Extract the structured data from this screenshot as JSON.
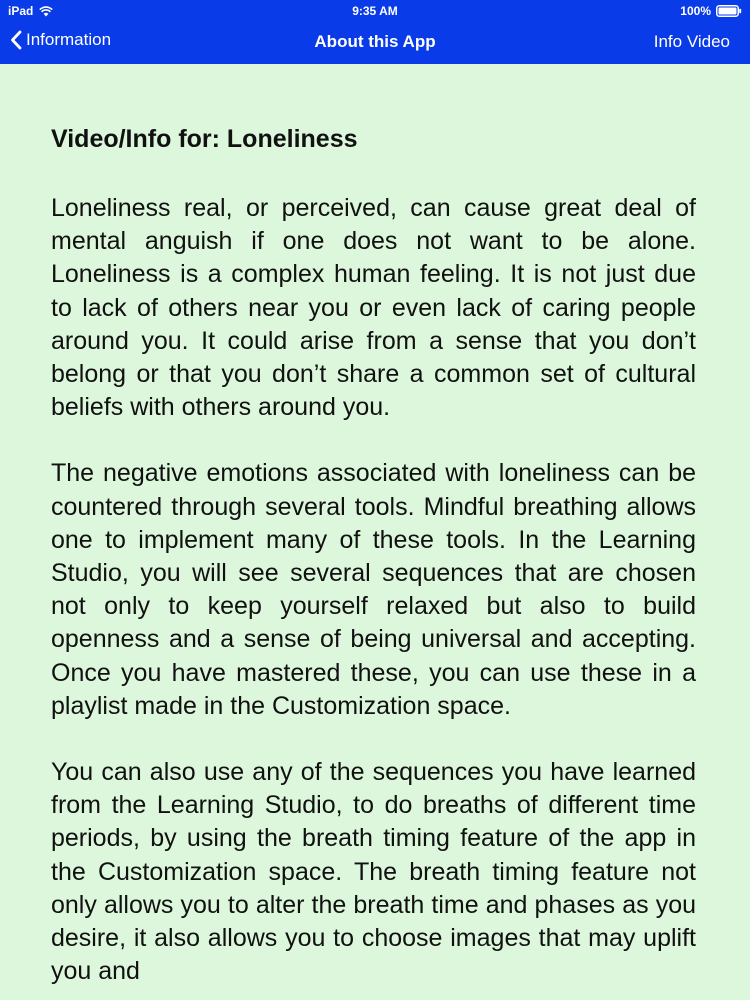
{
  "status_bar": {
    "device": "iPad",
    "time": "9:35 AM",
    "battery": "100%"
  },
  "nav": {
    "back_label": "Information",
    "title": "About this App",
    "right_label": "Info Video"
  },
  "content": {
    "heading": "Video/Info for: Loneliness",
    "paragraphs": [
      "Loneliness real, or perceived, can cause great deal of mental anguish if one does not want to be alone. Loneliness is a complex human feeling. It is not just due to lack of others near you or even lack of caring people around you. It could arise from a sense that you don’t belong or that you don’t share a common set of cultural beliefs with others around you.",
      "The negative emotions associated with loneliness can be countered through several tools.  Mindful breathing allows one to implement many of these tools. In the Learning Studio, you will see several sequences that are chosen not only to keep yourself relaxed but also to build openness and a sense of being universal and accepting. Once you have mastered these, you can use these in a playlist made in the Customization space.",
      "You can also use any of the sequences you have learned from the Learning Studio, to do breaths of different time periods, by using the breath timing feature of the app in the Customization space. The breath timing feature not only allows you to alter the breath time and phases as you desire, it also allows you to choose images that may uplift you and"
    ]
  },
  "colors": {
    "nav_background": "#0a3be8",
    "content_background": "#dcf7dc",
    "text": "#111111"
  },
  "icons": {
    "wifi": "wifi-icon",
    "battery": "battery-icon",
    "back": "chevron-left-icon"
  }
}
